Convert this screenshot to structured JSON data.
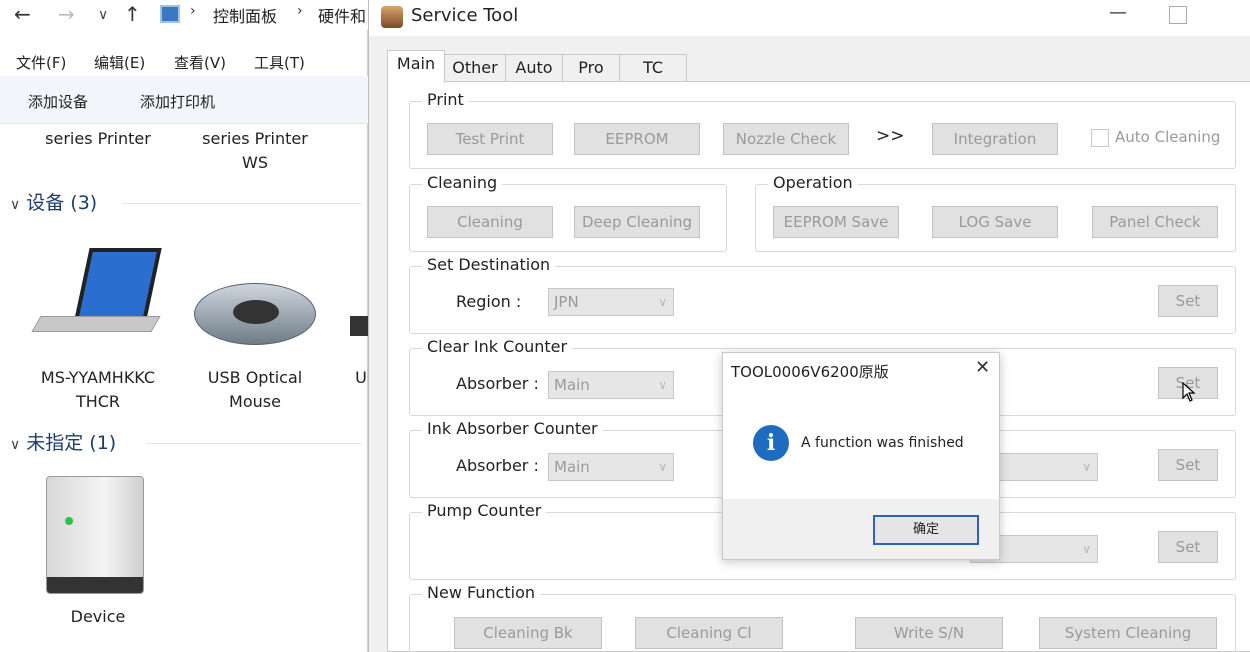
{
  "explorer": {
    "address": {
      "crumb1": "控制面板",
      "crumb2": "硬件和"
    },
    "menu": [
      "文件(F)",
      "编辑(E)",
      "查看(V)",
      "工具(T)"
    ],
    "toolbar": [
      "添加设备",
      "添加打印机"
    ],
    "top_items": [
      "series Printer",
      "series Printer WS"
    ],
    "groups": {
      "devices": {
        "title": "设备 (3)",
        "items": [
          "MS-YYAMHKKC THCR",
          "USB Optical Mouse",
          "U"
        ]
      },
      "unspecified": {
        "title": "未指定 (1)",
        "items": [
          "Device"
        ]
      }
    }
  },
  "service_tool": {
    "title": "Service Tool",
    "window_controls": {
      "minimize": "—"
    },
    "tabs": [
      "Main",
      "Other",
      "Auto",
      "Pro",
      "TC"
    ],
    "active_tab": "Main",
    "print": {
      "title": "Print",
      "buttons": [
        "Test Print",
        "EEPROM",
        "Nozzle Check",
        "Integration"
      ],
      "arrow": ">>",
      "auto_cleaning": {
        "label": "Auto Cleaning",
        "checked": false
      }
    },
    "cleaning": {
      "title": "Cleaning",
      "buttons": [
        "Cleaning",
        "Deep Cleaning"
      ]
    },
    "operation": {
      "title": "Operation",
      "buttons": [
        "EEPROM Save",
        "LOG Save",
        "Panel Check"
      ]
    },
    "set_destination": {
      "title": "Set Destination",
      "label": "Region :",
      "value": "JPN",
      "set": "Set"
    },
    "clear_ink_counter": {
      "title": "Clear Ink Counter",
      "label": "Absorber :",
      "value": "Main",
      "set": "Set"
    },
    "ink_absorber_counter": {
      "title": "Ink Absorber Counter",
      "label": "Absorber :",
      "value": "Main",
      "set": "Set"
    },
    "pump_counter": {
      "title": "Pump Counter",
      "set": "Set"
    },
    "new_function": {
      "title": "New Function",
      "buttons": [
        "Cleaning Bk",
        "Cleaning Cl",
        "Write S/N",
        "System Cleaning"
      ]
    }
  },
  "dialog": {
    "title": "TOOL0006V6200原版",
    "close": "✕",
    "icon": "info-icon",
    "message": "A function was finished",
    "ok": "确定"
  },
  "colors": {
    "info_blue": "#1e6cc0",
    "disabled_text": "#9a9a9a",
    "dialog_focus": "#2b63b8"
  }
}
